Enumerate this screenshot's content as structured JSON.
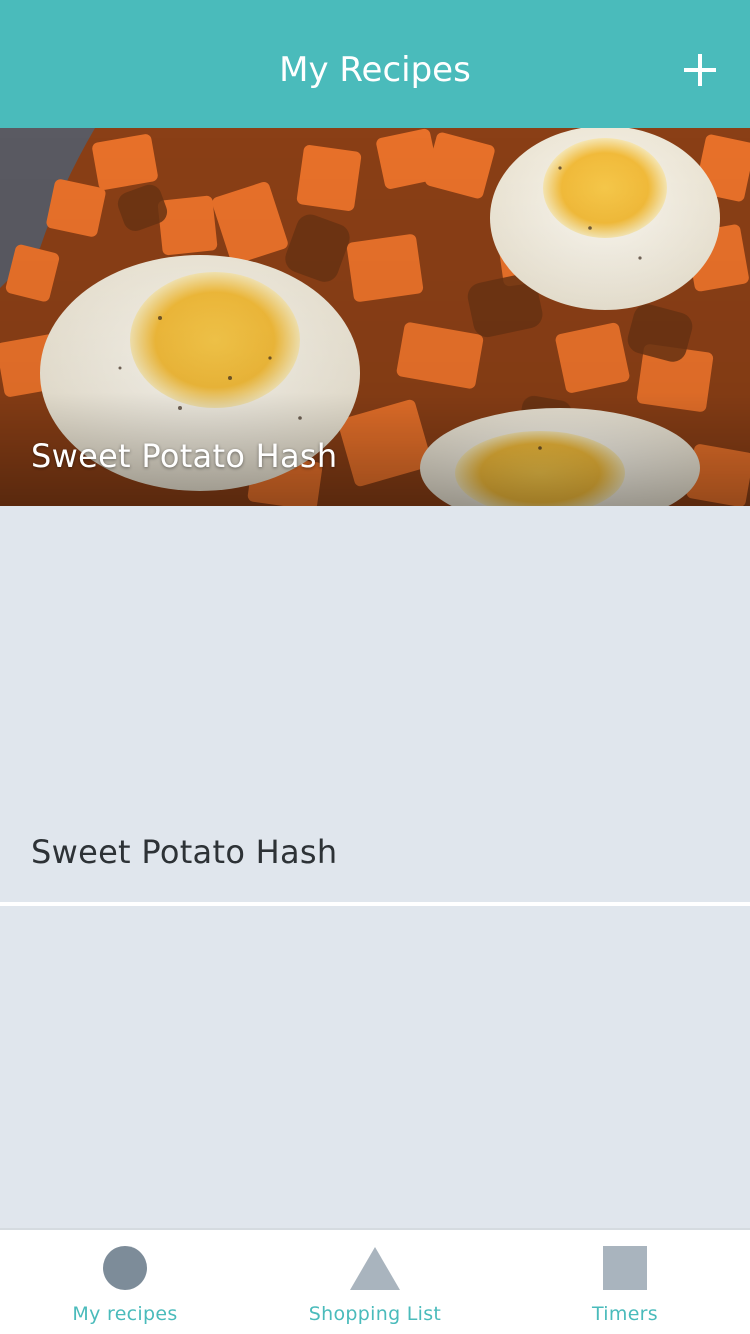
{
  "header": {
    "title": "My Recipes",
    "add_icon": "plus-icon"
  },
  "recipes": [
    {
      "title": "Sweet Potato Hash",
      "has_image": true
    },
    {
      "title": "Sweet Potato Hash",
      "has_image": false
    },
    {
      "title": "",
      "has_image": false
    }
  ],
  "tabs": [
    {
      "label": "My recipes",
      "icon": "circle-icon"
    },
    {
      "label": "Shopping List",
      "icon": "triangle-icon"
    },
    {
      "label": "Timers",
      "icon": "square-icon"
    }
  ],
  "colors": {
    "accent": "#4abbbb",
    "background": "#e0e6ed",
    "tab_icon": "#a9b4be",
    "tab_icon_active": "#7d8c99"
  }
}
